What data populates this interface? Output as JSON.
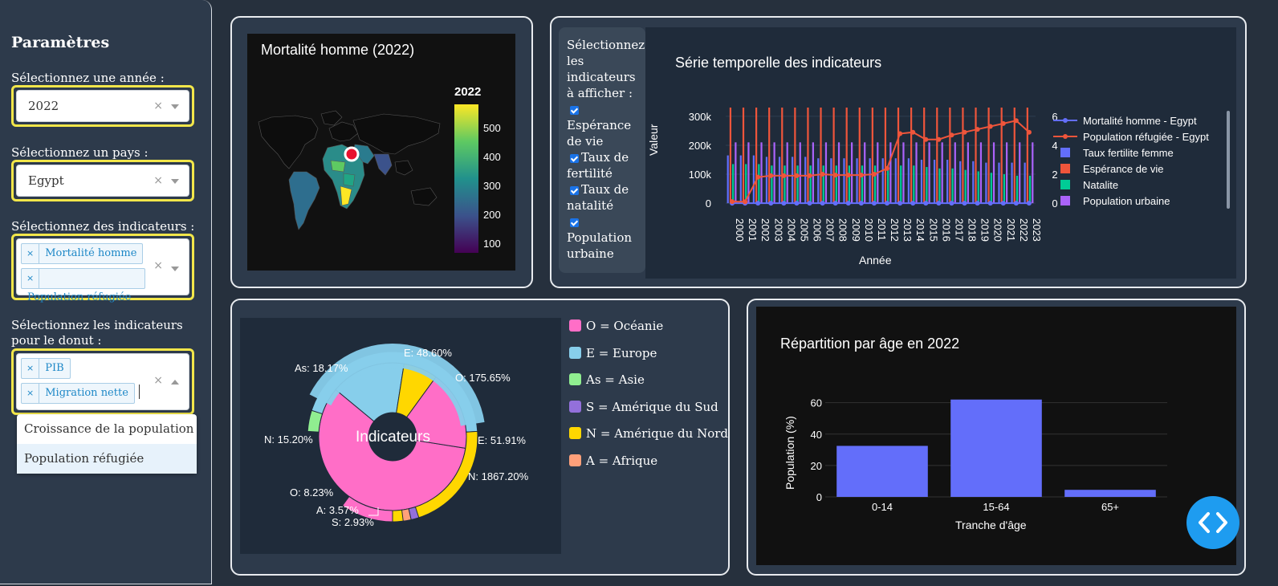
{
  "sidebar": {
    "title": "Paramètres",
    "year_label": "Sélectionnez une année :",
    "year_value": "2022",
    "country_label": "Sélectionnez un pays :",
    "country_value": "Egypt",
    "indicators_label": "Sélectionnez des indicateurs :",
    "indicators_tags": [
      "Mortalité homme",
      "Population réfugiée"
    ],
    "donut_label": "Sélectionnez les indicateurs pour le donut :",
    "donut_tags": [
      "PIB",
      "Migration nette"
    ],
    "donut_menu": [
      "Croissance de la population",
      "Population réfugiée"
    ],
    "clear_symbol": "×",
    "tag_remove_symbol": "×"
  },
  "map": {
    "title": "Mortalité homme (2022)",
    "colorbar_title": "2022",
    "colorbar_ticks": [
      "500",
      "400",
      "300",
      "200",
      "100"
    ],
    "colors": [
      "#fde725",
      "#5ec962",
      "#21918c",
      "#3b528b",
      "#440154"
    ]
  },
  "timeseries": {
    "checklist_title": "Sélectionnez les indicateurs à afficher :",
    "checklist_items": [
      "Espérance de vie",
      "Taux de fertilité",
      "Taux de natalité",
      "Population urbaine"
    ],
    "chart_data": {
      "type": "bar",
      "title": "Série temporelle des indicateurs",
      "xlabel": "Année",
      "ylabel": "Valeur",
      "categories": [
        "2000",
        "2001",
        "2002",
        "2003",
        "2004",
        "2005",
        "2006",
        "2007",
        "2008",
        "2009",
        "2010",
        "2011",
        "2012",
        "2013",
        "2014",
        "2015",
        "2016",
        "2017",
        "2018",
        "2019",
        "2020",
        "2021",
        "2022",
        "2023"
      ],
      "y_ticks": [
        "300k",
        "200k",
        "100k",
        "0"
      ],
      "y2_ticks": [
        "6",
        "4",
        "2",
        "0"
      ],
      "ylim": [
        -30000,
        330000
      ],
      "y2lim": [
        -0.6,
        6.6
      ],
      "series": [
        {
          "name": "Mortalité homme - Egypt",
          "type": "line",
          "axis": "y",
          "color": "#636efa",
          "values": [
            200,
            200,
            200,
            200,
            200,
            200,
            200,
            200,
            200,
            200,
            200,
            200,
            200,
            200,
            200,
            200,
            200,
            200,
            200,
            200,
            200,
            200,
            200,
            200
          ]
        },
        {
          "name": "Population réfugiée - Egypt",
          "type": "line",
          "axis": "y",
          "color": "#ef553b",
          "values": [
            5500,
            5000,
            90000,
            95000,
            95000,
            95000,
            95000,
            100000,
            97000,
            97000,
            97000,
            100000,
            120000,
            240000,
            245000,
            220000,
            220000,
            235000,
            245000,
            255000,
            265000,
            275000,
            285000,
            245000
          ]
        },
        {
          "name": "Taux fertilite femme",
          "type": "bar",
          "axis": "y2",
          "color": "#636efa",
          "values": [
            3.3,
            3.3,
            3.3,
            3.2,
            3.2,
            3.2,
            3.2,
            3.1,
            3.1,
            3.1,
            3.1,
            3.1,
            3.1,
            3.1,
            3.1,
            3.0,
            3.0,
            3.0,
            2.9,
            2.9,
            2.8,
            2.8,
            2.8,
            2.8
          ]
        },
        {
          "name": "Espérance de vie",
          "type": "bar",
          "axis": "y2",
          "color": "#ef553b",
          "values": [
            6.6,
            6.6,
            6.6,
            6.6,
            6.6,
            6.6,
            6.6,
            6.6,
            6.6,
            6.6,
            6.6,
            6.6,
            6.6,
            6.6,
            6.6,
            6.6,
            6.6,
            6.6,
            6.6,
            6.6,
            6.6,
            6.6,
            6.6,
            6.6
          ]
        },
        {
          "name": "Natalite",
          "type": "bar",
          "axis": "y2",
          "color": "#00cc96",
          "values": [
            2.7,
            2.7,
            2.7,
            2.6,
            2.6,
            2.6,
            2.6,
            2.6,
            2.6,
            2.6,
            2.6,
            2.6,
            2.6,
            2.6,
            2.6,
            2.5,
            2.4,
            2.4,
            2.3,
            2.2,
            2.1,
            2.0,
            1.9,
            1.9
          ]
        },
        {
          "name": "Population urbaine",
          "type": "bar",
          "axis": "y2",
          "color": "#ab63fa",
          "values": [
            4.2,
            4.2,
            4.2,
            4.2,
            4.2,
            4.2,
            4.2,
            4.2,
            4.2,
            4.2,
            4.2,
            4.2,
            4.2,
            4.2,
            4.2,
            4.2,
            4.2,
            4.2,
            4.2,
            4.2,
            4.2,
            4.2,
            4.2,
            4.2
          ]
        }
      ]
    }
  },
  "donut": {
    "center_label": "Indicateurs",
    "legend": [
      {
        "code": "O = Océanie",
        "color": "#ff6ec7"
      },
      {
        "code": "E = Europe",
        "color": "#87ceeb"
      },
      {
        "code": "As = Asie",
        "color": "#90ee90"
      },
      {
        "code": "S = Amérique du Sud",
        "color": "#9370db"
      },
      {
        "code": "N = Amérique du Nord",
        "color": "#ffd700"
      },
      {
        "code": "A = Afrique",
        "color": "#ffa07a"
      }
    ],
    "chart_data": {
      "type": "pie",
      "rings": [
        {
          "name": "inner",
          "slices": [
            {
              "label": "O",
              "value": 175.65,
              "color": "#ff6ec7"
            },
            {
              "label": "E",
              "value": 48.6,
              "color": "#87ceeb"
            },
            {
              "label": "N",
              "value": 15.2,
              "color": "#ffd700"
            }
          ]
        },
        {
          "name": "outer",
          "slices": [
            {
              "label": "E",
              "value": 51.91,
              "color": "#87ceeb"
            },
            {
              "label": "N",
              "value": 1867.2,
              "color": "#ffd700"
            },
            {
              "label": "S",
              "value": 2.93,
              "color": "#9370db"
            },
            {
              "label": "A",
              "value": 3.57,
              "color": "#ffa07a"
            },
            {
              "label": "O",
              "value": 8.23,
              "color": "#ff6ec7"
            },
            {
              "label": "As",
              "value": 18.17,
              "color": "#90ee90"
            }
          ]
        }
      ],
      "labels": [
        "E: 48.60%",
        "As: 18.17%",
        "O: 175.65%",
        "N: 15.20%",
        "E: 51.91%",
        "O: 8.23%",
        "N: 1867.20%",
        "A: 3.57%",
        "S: 2.93%"
      ]
    }
  },
  "agebar": {
    "chart_data": {
      "type": "bar",
      "title": "Répartition par âge en 2022",
      "xlabel": "Tranche d'âge",
      "ylabel": "Population (%)",
      "categories": [
        "0-14",
        "15-64",
        "65+"
      ],
      "values": [
        32.5,
        62.0,
        4.5
      ],
      "ylim": [
        0,
        68
      ],
      "y_ticks": [
        0,
        20,
        40,
        60
      ],
      "color": "#636efa"
    }
  },
  "code_toggle": {
    "glyph": "< >"
  }
}
